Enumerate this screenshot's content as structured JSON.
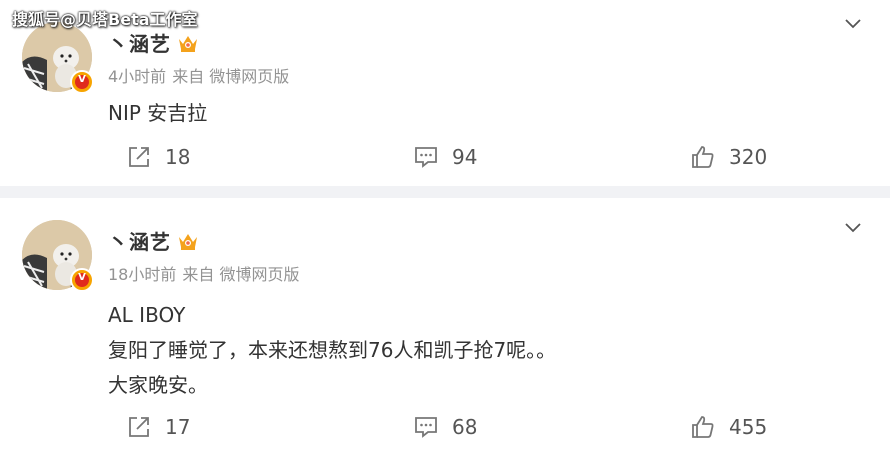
{
  "watermark": "搜狐号@贝塔Beta工作室",
  "posts": [
    {
      "author": "丶涵艺",
      "time": "4小时前",
      "source": "来自 微博网页版",
      "lines": [
        "NIP 安吉拉"
      ],
      "reposts": "18",
      "comments": "94",
      "likes": "320"
    },
    {
      "author": "丶涵艺",
      "time": "18小时前",
      "source": "来自 微博网页版",
      "lines": [
        "AL IBOY",
        "复阳了睡觉了，本来还想熬到76人和凯子抢7呢。。",
        "大家晚安。"
      ],
      "reposts": "17",
      "comments": "68",
      "likes": "455"
    }
  ],
  "icons": {
    "repost": "repost-icon",
    "comment": "comment-icon",
    "like": "like-icon",
    "more": "chevron-down-icon",
    "badge": "verified-badge-icon",
    "crown": "crown-icon"
  },
  "colors": {
    "text": "#333333",
    "meta": "#939393",
    "divider": "#f1f2f5",
    "badge_outer": "#f7a400",
    "badge_inner": "#e02b1d",
    "crown": "#f4a21c"
  }
}
